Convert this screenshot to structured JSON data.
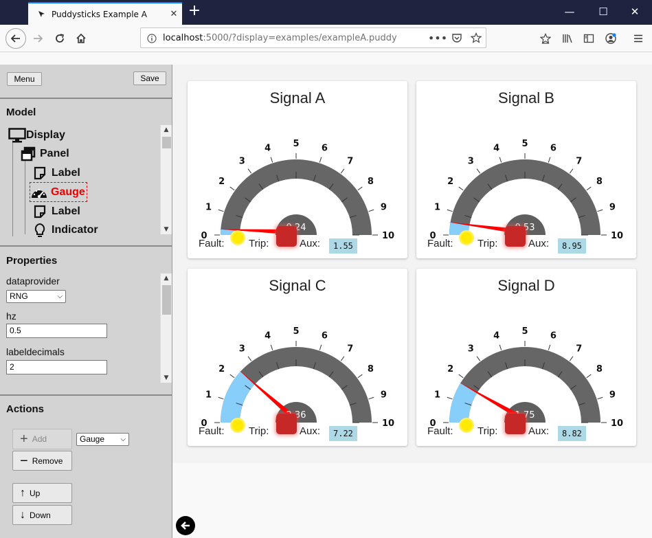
{
  "browser": {
    "tab_title": "Puddysticks Example A",
    "new_tab": "+",
    "url_host": "localhost",
    "url_rest": ":5000/?display=examples/exampleA.puddy"
  },
  "sidebar": {
    "menu_button": "Menu",
    "save_button": "Save",
    "model_title": "Model",
    "tree": [
      {
        "label": "Display",
        "icon": "monitor-icon"
      },
      {
        "label": "Panel",
        "icon": "panel-icon"
      },
      {
        "label": "Label",
        "icon": "label-icon"
      },
      {
        "label": "Gauge",
        "icon": "gauge-icon",
        "selected": true
      },
      {
        "label": "Label",
        "icon": "label-icon"
      },
      {
        "label": "Indicator",
        "icon": "bulb-icon"
      }
    ],
    "properties_title": "Properties",
    "properties": {
      "dataprovider_label": "dataprovider",
      "dataprovider_value": "RNG",
      "hz_label": "hz",
      "hz_value": "0.5",
      "labeldecimals_label": "labeldecimals",
      "labeldecimals_value": "2"
    },
    "actions_title": "Actions",
    "actions": {
      "add": "Add",
      "add_type": "Gauge",
      "remove": "Remove",
      "up": "Up",
      "down": "Down"
    }
  },
  "widgets": {
    "tick_labels": [
      "0",
      "1",
      "2",
      "3",
      "4",
      "5",
      "6",
      "7",
      "8",
      "9",
      "10"
    ],
    "range": [
      0,
      10
    ],
    "fault_label": "Fault:",
    "trip_label": "Trip:",
    "aux_label": "Aux:",
    "colors": {
      "arc": "#666666",
      "fill": "#87cefa",
      "needle": "#ff0000",
      "fault": "#ffea00",
      "trip": "#c62828",
      "aux_bg": "#add8e6"
    },
    "signals": [
      {
        "title": "Signal A",
        "value": 0.24,
        "value_label": "0.24",
        "aux": "1.55"
      },
      {
        "title": "Signal B",
        "value": 0.53,
        "value_label": "0.53",
        "aux": "8.95"
      },
      {
        "title": "Signal C",
        "value": 2.36,
        "value_label": "2.36",
        "aux": "7.22"
      },
      {
        "title": "Signal D",
        "value": 1.75,
        "value_label": "1.75",
        "aux": "8.82"
      }
    ]
  }
}
